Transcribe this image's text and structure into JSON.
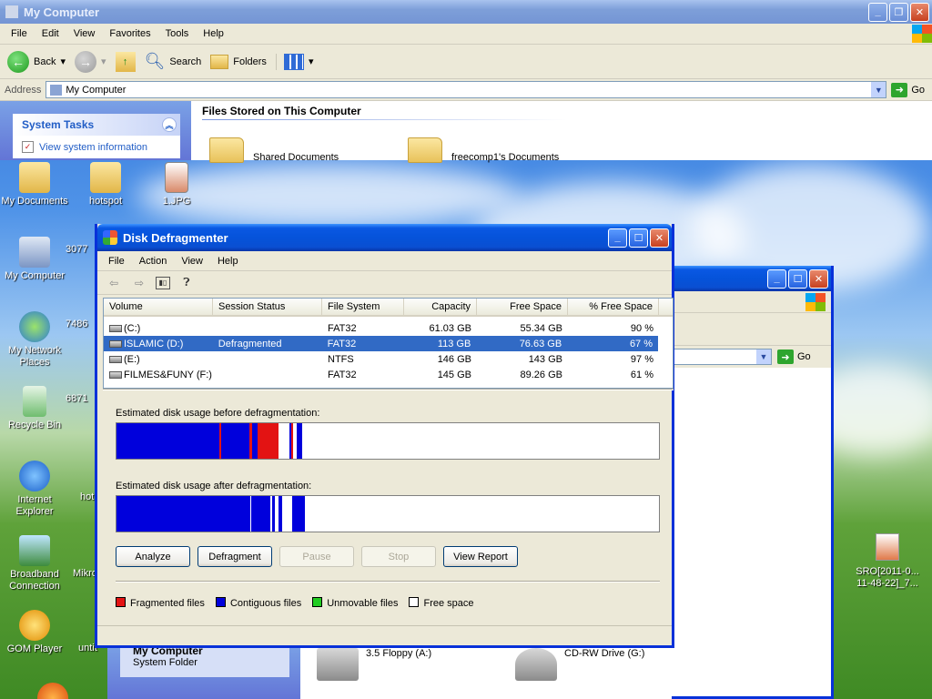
{
  "mycomputer": {
    "title": "My Computer",
    "menu": [
      "File",
      "Edit",
      "View",
      "Favorites",
      "Tools",
      "Help"
    ],
    "toolbar": {
      "back": "Back",
      "search": "Search",
      "folders": "Folders"
    },
    "address_label": "Address",
    "address_value": "My Computer",
    "go_label": "Go",
    "system_tasks": {
      "title": "System Tasks",
      "link": "View system information"
    },
    "files_heading": "Files Stored on This Computer",
    "folders": [
      "Shared Documents",
      "freecomp1's Documents"
    ]
  },
  "desktop": {
    "icons": [
      {
        "label": "My Documents"
      },
      {
        "label": "hotspot"
      },
      {
        "label": "1.JPG"
      },
      {
        "label": "My Computer"
      },
      {
        "label": "3077"
      },
      {
        "label": "My Network Places"
      },
      {
        "label": "7486"
      },
      {
        "label": "Recycle Bin"
      },
      {
        "label": "6871"
      },
      {
        "label": "Internet Explorer"
      },
      {
        "label": "hot"
      },
      {
        "label": "Broadband Connection"
      },
      {
        "label": "Mikro"
      },
      {
        "label": "GOM Player"
      },
      {
        "label": "untit"
      }
    ],
    "right_file": "SRO[2011-0... 11-48-22]_7..."
  },
  "bgwindow": {
    "go_label": "Go",
    "task_title": "My Computer",
    "task_sub": "System Folder",
    "drives": [
      "3.5 Floppy (A:)",
      "CD-RW Drive (G:)"
    ]
  },
  "defrag": {
    "title": "Disk Defragmenter",
    "menu": [
      "File",
      "Action",
      "View",
      "Help"
    ],
    "columns": [
      "Volume",
      "Session Status",
      "File System",
      "Capacity",
      "Free Space",
      "% Free Space"
    ],
    "volumes": [
      {
        "volume": "(C:)",
        "status": "",
        "fs": "FAT32",
        "capacity": "61.03 GB",
        "free": "55.34 GB",
        "pct": "90 %"
      },
      {
        "volume": "ISLAMIC (D:)",
        "status": "Defragmented",
        "fs": "FAT32",
        "capacity": "113 GB",
        "free": "76.63 GB",
        "pct": "67 %"
      },
      {
        "volume": "(E:)",
        "status": "",
        "fs": "NTFS",
        "capacity": "146 GB",
        "free": "143 GB",
        "pct": "97 %"
      },
      {
        "volume": "FILMES&FUNY (F:)",
        "status": "",
        "fs": "FAT32",
        "capacity": "145 GB",
        "free": "89.26 GB",
        "pct": "61 %"
      }
    ],
    "before_label": "Estimated disk usage before defragmentation:",
    "after_label": "Estimated disk usage after defragmentation:",
    "buttons": {
      "analyze": "Analyze",
      "defragment": "Defragment",
      "pause": "Pause",
      "stop": "Stop",
      "report": "View Report"
    },
    "legend": [
      "Fragmented files",
      "Contiguous files",
      "Unmovable files",
      "Free space"
    ],
    "colors": {
      "fragmented": "#e31313",
      "contiguous": "#0000dc",
      "unmovable": "#22cc22",
      "free": "#ffffff"
    },
    "before_segments": [
      {
        "type": "contiguous",
        "from": 0.0,
        "to": 0.19
      },
      {
        "type": "fragmented",
        "from": 0.19,
        "to": 0.193
      },
      {
        "type": "contiguous",
        "from": 0.193,
        "to": 0.245
      },
      {
        "type": "fragmented",
        "from": 0.245,
        "to": 0.25
      },
      {
        "type": "contiguous",
        "from": 0.25,
        "to": 0.26
      },
      {
        "type": "fragmented",
        "from": 0.26,
        "to": 0.298
      },
      {
        "type": "contiguous",
        "from": 0.318,
        "to": 0.322
      },
      {
        "type": "fragmented",
        "from": 0.322,
        "to": 0.326
      },
      {
        "type": "contiguous",
        "from": 0.333,
        "to": 0.343
      }
    ],
    "after_segments": [
      {
        "type": "contiguous",
        "from": 0.0,
        "to": 0.246
      },
      {
        "type": "contiguous",
        "from": 0.249,
        "to": 0.283
      },
      {
        "type": "contiguous",
        "from": 0.287,
        "to": 0.292
      },
      {
        "type": "contiguous",
        "from": 0.298,
        "to": 0.305
      },
      {
        "type": "contiguous",
        "from": 0.323,
        "to": 0.348
      }
    ]
  }
}
